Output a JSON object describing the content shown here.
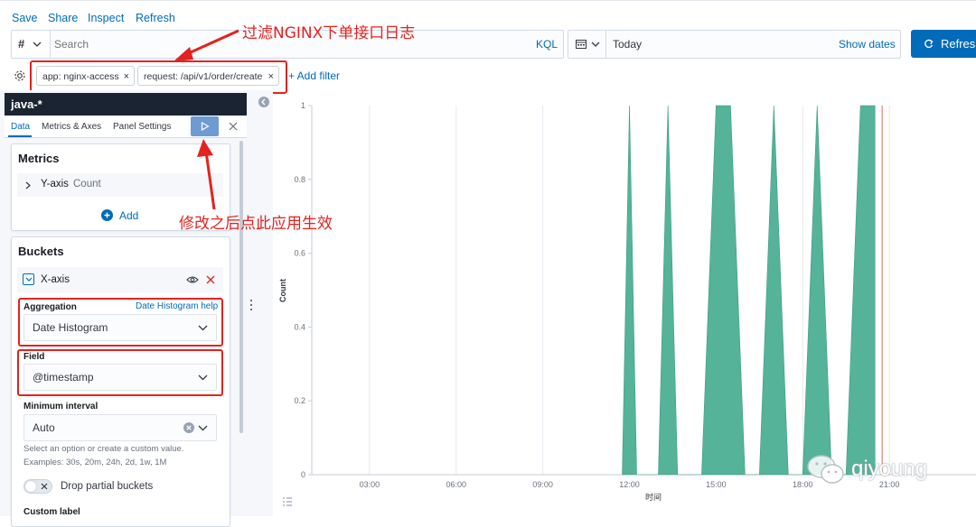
{
  "topnav": {
    "save": "Save",
    "share": "Share",
    "inspect": "Inspect",
    "refresh": "Refresh"
  },
  "query": {
    "lang_symbol": "#",
    "placeholder": "Search",
    "language": "KQL"
  },
  "date": {
    "value": "Today",
    "show_dates": "Show dates"
  },
  "refresh_button": {
    "label": "Refres"
  },
  "filters": [
    {
      "label": "app: nginx-access"
    },
    {
      "label": "request: /api/v1/order/create"
    }
  ],
  "add_filter": "+ Add filter",
  "sidebar": {
    "index_pattern": "java-*",
    "tabs": [
      "Data",
      "Metrics & Axes",
      "Panel Settings"
    ],
    "metrics": {
      "title": "Metrics",
      "y_axis": "Y-axis",
      "y_axis_agg": "Count",
      "add": "Add"
    },
    "buckets": {
      "title": "Buckets",
      "x_axis": "X-axis",
      "aggregation_label": "Aggregation",
      "aggregation_help": "Date Histogram help",
      "aggregation_value": "Date Histogram",
      "field_label": "Field",
      "field_value": "@timestamp",
      "min_interval_label": "Minimum interval",
      "min_interval_value": "Auto",
      "help_text_1": "Select an option or create a custom value.",
      "help_text_2": "Examples: 30s, 20m, 24h, 2d, 1w, 1M",
      "drop_partial": "Drop partial buckets",
      "custom_label": "Custom label"
    }
  },
  "annotations": {
    "filter_note": "过滤NGINX下单接口日志",
    "apply_note": "修改之后点此应用生效"
  },
  "watermark": "qiyoung",
  "colors": {
    "series": "#54b399",
    "accent": "#006bb8",
    "annotation": "#e3231f",
    "now_line": "#e7664c"
  },
  "chart_data": {
    "type": "area",
    "xlabel": "时间",
    "ylabel": "Count",
    "ylim": [
      0,
      1
    ],
    "y_ticks": [
      "0",
      "0.2",
      "0.4",
      "0.6",
      "0.8",
      "1"
    ],
    "x_ticks": [
      "03:00",
      "06:00",
      "09:00",
      "12:00",
      "15:00",
      "18:00",
      "21:00"
    ],
    "series": [
      {
        "x": [
          "11:45",
          "12:00",
          "12:15",
          "13:00",
          "13:20",
          "13:40",
          "14:30",
          "15:00",
          "15:30",
          "16:00",
          "16:30",
          "17:00",
          "17:30",
          "18:00",
          "18:30",
          "19:00",
          "19:30",
          "20:00",
          "20:30"
        ],
        "values": [
          0,
          1,
          0,
          0,
          1,
          0,
          0,
          1,
          1,
          0,
          0,
          1,
          0,
          0,
          1,
          0,
          0,
          1,
          1
        ]
      }
    ],
    "grid": true,
    "now_marker": "20:45"
  }
}
